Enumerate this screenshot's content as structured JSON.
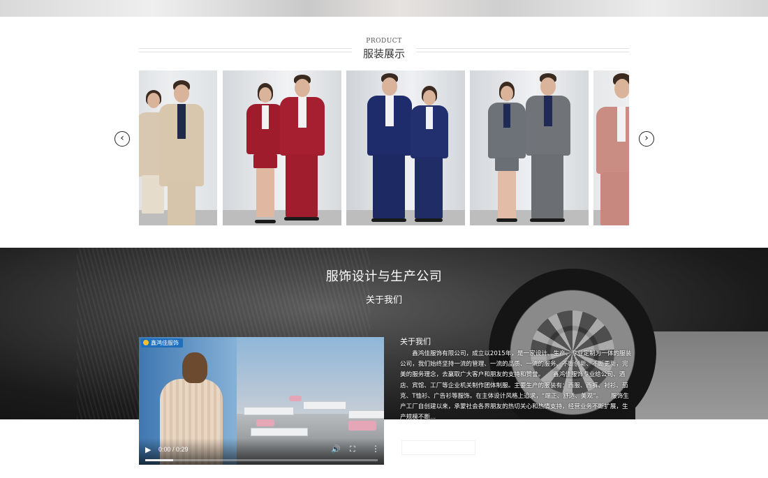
{
  "product_section": {
    "subtitle": "PRODUCT",
    "title": "服装展示"
  },
  "carousel": {
    "prev_icon": "chevron-left-icon",
    "next_icon": "chevron-right-icon",
    "prev_glyph": "‹",
    "next_glyph": "›"
  },
  "about_section": {
    "title": "服饰设计与生产公司",
    "subtitle": "关于我们",
    "heading": "关于我们",
    "body": "鑫鸿佳服饰有限公司，成立以2015年，是一家设计、生产、专业定制为一体的服装公司，我们始终坚持一流的管理、一流的品质、一流的服务、不断创新、不断更新，完美的服务理念，去赢取广大客户和朋友的支持和赞誉。　　鑫鸿佳服饰专业给公司、酒店、宾馆、工厂等企业机关制作团体制服。主要生产的服装有：西服、西裤、衬衫、茄克、T恤衫、广告衫等服饰。在主体设计风格上追求，“端正、舒适、美观”。　　服饰生产工厂自创建以来，承蒙社会各界朋友的热切关心和热情支持，经营业务不断扩展，生产规模不断..."
  },
  "video": {
    "logo_text": "鑫鸿佳服饰",
    "time": "0:00 / 0:29",
    "progress": 0.12,
    "play_icon": "play-icon",
    "volume_icon": "volume-icon",
    "fullscreen_icon": "fullscreen-icon",
    "more_icon": "more-vertical-icon"
  }
}
